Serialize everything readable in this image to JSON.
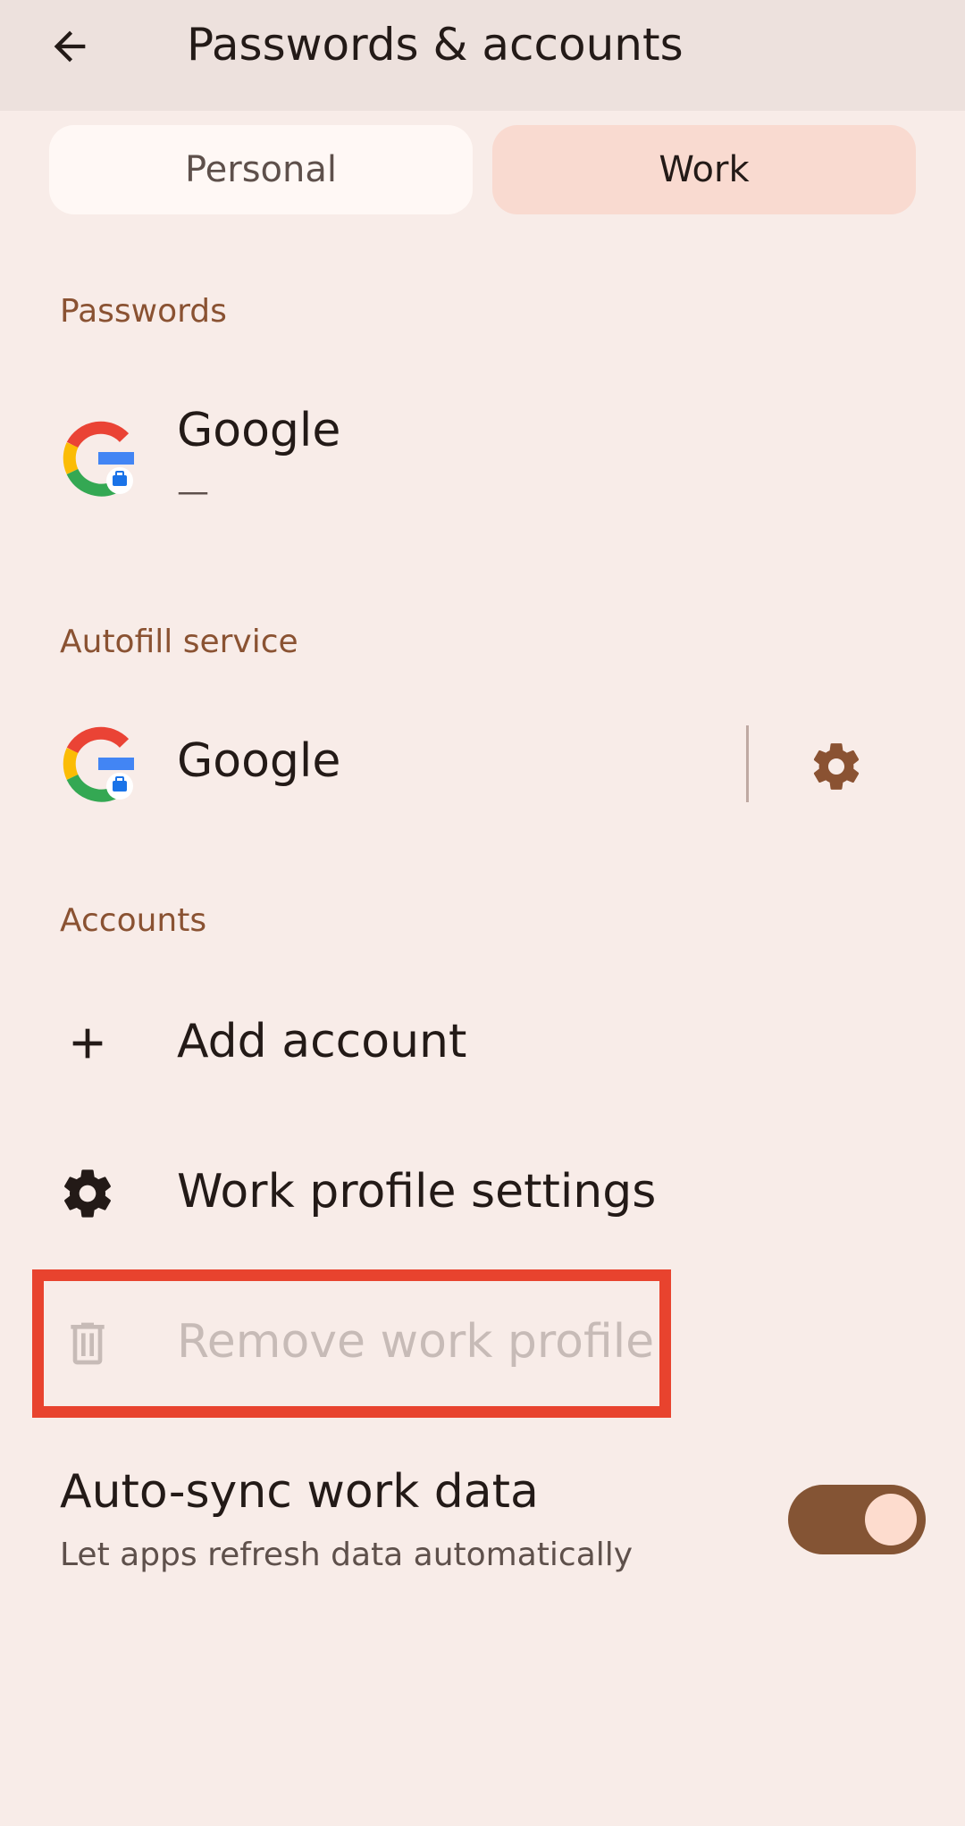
{
  "appbar": {
    "title": "Passwords & accounts",
    "back_icon": "arrow-back-icon"
  },
  "tabs": [
    {
      "label": "Personal",
      "selected": false
    },
    {
      "label": "Work",
      "selected": true
    }
  ],
  "passwords": {
    "header": "Passwords",
    "item": {
      "title": "Google",
      "subtitle": "—",
      "icon": "google-work-icon"
    }
  },
  "autofill": {
    "header": "Autofill service",
    "item": {
      "title": "Google",
      "icon": "google-work-icon",
      "settings_icon": "gear-icon"
    }
  },
  "accounts": {
    "header": "Accounts",
    "add_account": {
      "label": "Add account",
      "icon": "plus-icon"
    },
    "work_profile_settings": {
      "label": "Work profile settings",
      "icon": "gear-icon"
    },
    "remove_work_profile": {
      "label": "Remove work profile",
      "icon": "trash-icon",
      "enabled": false
    }
  },
  "auto_sync": {
    "title": "Auto-sync work data",
    "subtitle": "Let apps refresh data automatically",
    "enabled": true
  },
  "colors": {
    "background": "#F8ECE8",
    "appbar": "#EDE1DD",
    "accent": "#8A5232",
    "tab_selected": "#F9DAD0",
    "highlight": "#E8432E",
    "toggle_track": "#845434",
    "toggle_knob": "#FDDCCE"
  }
}
